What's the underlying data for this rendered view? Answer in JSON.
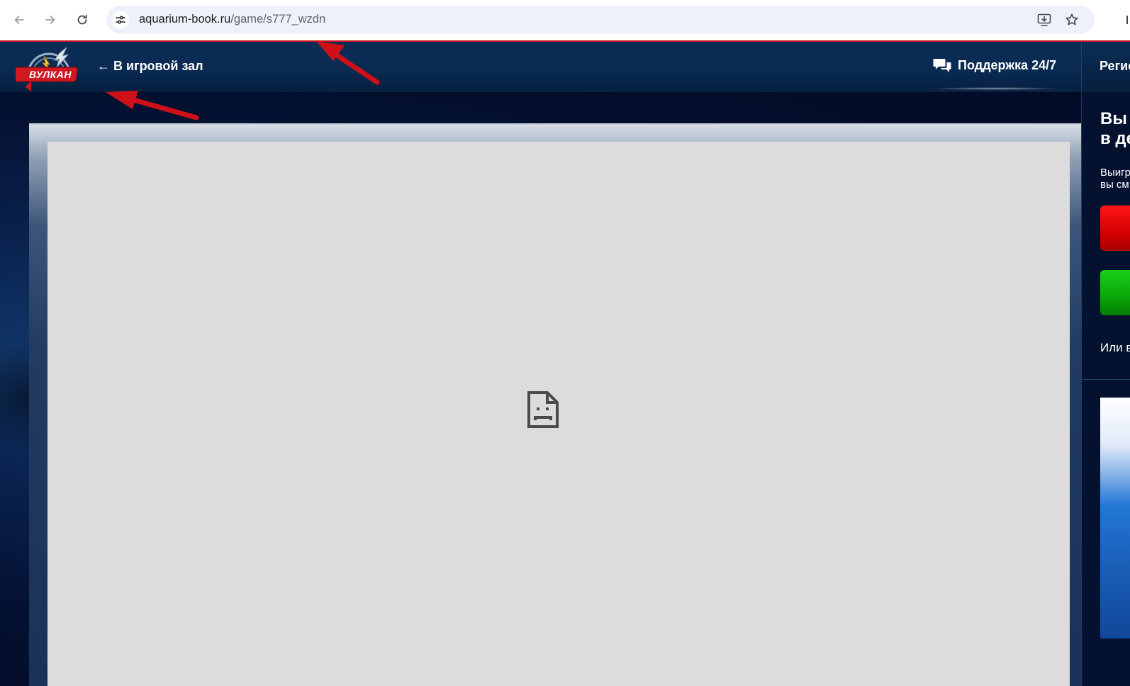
{
  "browser": {
    "url_host": "aquarium-book.ru",
    "url_path": "/game/s777_wzdn"
  },
  "header": {
    "logo_text": "ВУЛКАН",
    "back_link": "← В игровой зал",
    "support_label": "Поддержка 24/7",
    "register_label": "Регистрация"
  },
  "sidebar": {
    "title_line1": "Вы",
    "title_line2": "в де",
    "text_line1": "Выигр",
    "text_line2": "вы см",
    "or_text": "Или в"
  },
  "colors": {
    "header_bg": "#0b2d55",
    "accent_red": "#c8141c",
    "game_placeholder": "#dcdcdc",
    "button_red": "#e60000",
    "button_green": "#0aa60a",
    "annotation_arrow": "#d01018"
  },
  "icons": {
    "back": "arrow-left-icon",
    "forward": "arrow-right-icon",
    "reload": "reload-icon",
    "site_info": "tune-icon",
    "install": "install-app-icon",
    "bookmark": "star-icon",
    "support": "chat-bubbles-icon",
    "game_error": "sad-file-icon"
  }
}
